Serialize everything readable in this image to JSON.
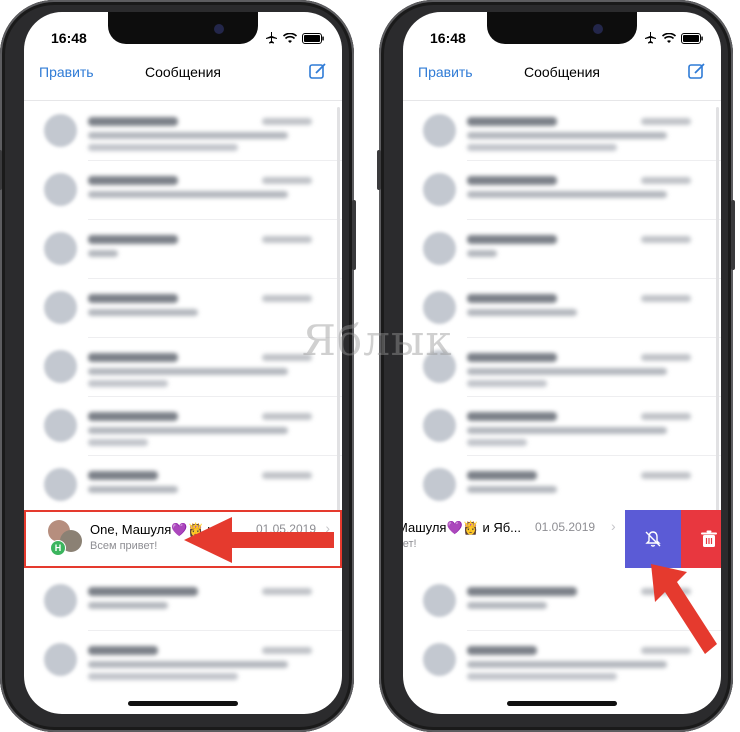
{
  "status": {
    "time": "16:48"
  },
  "nav": {
    "edit": "Править",
    "title": "Сообщения"
  },
  "focused_chat": {
    "title_left": "One, Машуля💜👸 и Я...",
    "title_right": "Машуля💜👸 и Яб...",
    "message": "Всем привет!",
    "message_right": "вет!",
    "date": "01.05.2019",
    "badge_initial": "Н"
  },
  "actions": {
    "mute": "bell-slash-icon",
    "delete": "trash-icon"
  },
  "watermark": "Яблык",
  "colors": {
    "accent": "#2f7bd6",
    "highlight": "#e53a2e",
    "mute_bg": "#5b5bd6",
    "delete_bg": "#e8373f"
  }
}
